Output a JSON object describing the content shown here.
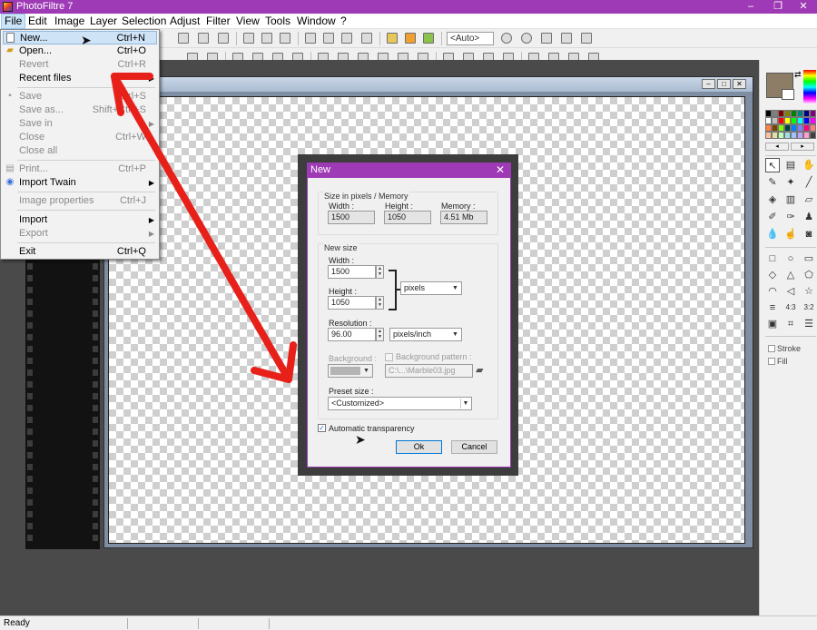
{
  "app": {
    "title": "PhotoFiltre 7",
    "window_controls": [
      "–",
      "❐",
      "✕"
    ]
  },
  "menubar": {
    "items": [
      "File",
      "Edit",
      "Image",
      "Layer",
      "Selection",
      "Adjust",
      "Filter",
      "View",
      "Tools",
      "Window",
      "?"
    ]
  },
  "toolbar": {
    "zoom_value": "<Auto>"
  },
  "file_menu": {
    "items": [
      {
        "label": "New...",
        "shortcut": "Ctrl+N",
        "state": "highlighted",
        "icon": "new-document-icon"
      },
      {
        "label": "Open...",
        "shortcut": "Ctrl+O",
        "state": "enabled",
        "icon": "open-folder-icon"
      },
      {
        "label": "Revert",
        "shortcut": "Ctrl+R",
        "state": "disabled"
      },
      {
        "label": "Recent files",
        "state": "enabled",
        "submenu": true
      },
      {
        "label": "Save",
        "shortcut": "Ctrl+S",
        "state": "disabled",
        "icon": "save-disk-icon"
      },
      {
        "label": "Save as...",
        "shortcut": "Shift+Ctrl+S",
        "state": "disabled"
      },
      {
        "label": "Save in",
        "state": "disabled",
        "submenu": true
      },
      {
        "label": "Close",
        "shortcut": "Ctrl+W",
        "state": "disabled"
      },
      {
        "label": "Close all",
        "state": "disabled"
      },
      {
        "label": "Print...",
        "shortcut": "Ctrl+P",
        "state": "disabled",
        "icon": "printer-icon"
      },
      {
        "label": "Import Twain",
        "state": "enabled",
        "submenu": true,
        "icon": "scanner-icon"
      },
      {
        "label": "Image properties",
        "shortcut": "Ctrl+J",
        "state": "disabled"
      },
      {
        "label": "Import",
        "state": "enabled",
        "submenu": true
      },
      {
        "label": "Export",
        "state": "disabled",
        "submenu": true
      },
      {
        "label": "Exit",
        "shortcut": "Ctrl+Q",
        "state": "enabled"
      }
    ]
  },
  "new_dialog": {
    "title": "New",
    "size_group": {
      "label": "Size in pixels / Memory",
      "width_label": "Width :",
      "width_value": "1500",
      "height_label": "Height :",
      "height_value": "1050",
      "memory_label": "Memory :",
      "memory_value": "4.51 Mb"
    },
    "new_size_group": {
      "label": "New size",
      "width_label": "Width :",
      "width_value": "1500",
      "height_label": "Height :",
      "height_value": "1050",
      "unit_value": "pixels",
      "resolution_label": "Resolution :",
      "resolution_value": "96.00",
      "resolution_unit_value": "pixels/inch",
      "background_label": "Background :",
      "background_pattern_label": "Background pattern :",
      "pattern_path": "C:\\...\\Marble03.jpg",
      "preset_label": "Preset size :",
      "preset_value": "<Customized>"
    },
    "auto_transparency": {
      "label": "Automatic transparency",
      "checked": true
    },
    "ok_label": "Ok",
    "cancel_label": "Cancel"
  },
  "right_panel": {
    "stroke_label": "Stroke",
    "fill_label": "Fill",
    "fg_color": "#8e7d66",
    "bg_color": "#ffffff"
  },
  "status": {
    "text": "Ready"
  },
  "colors": {
    "accent": "#9e3ab5",
    "arrow": "#e8201a",
    "workspace": "#4a4a4a"
  }
}
